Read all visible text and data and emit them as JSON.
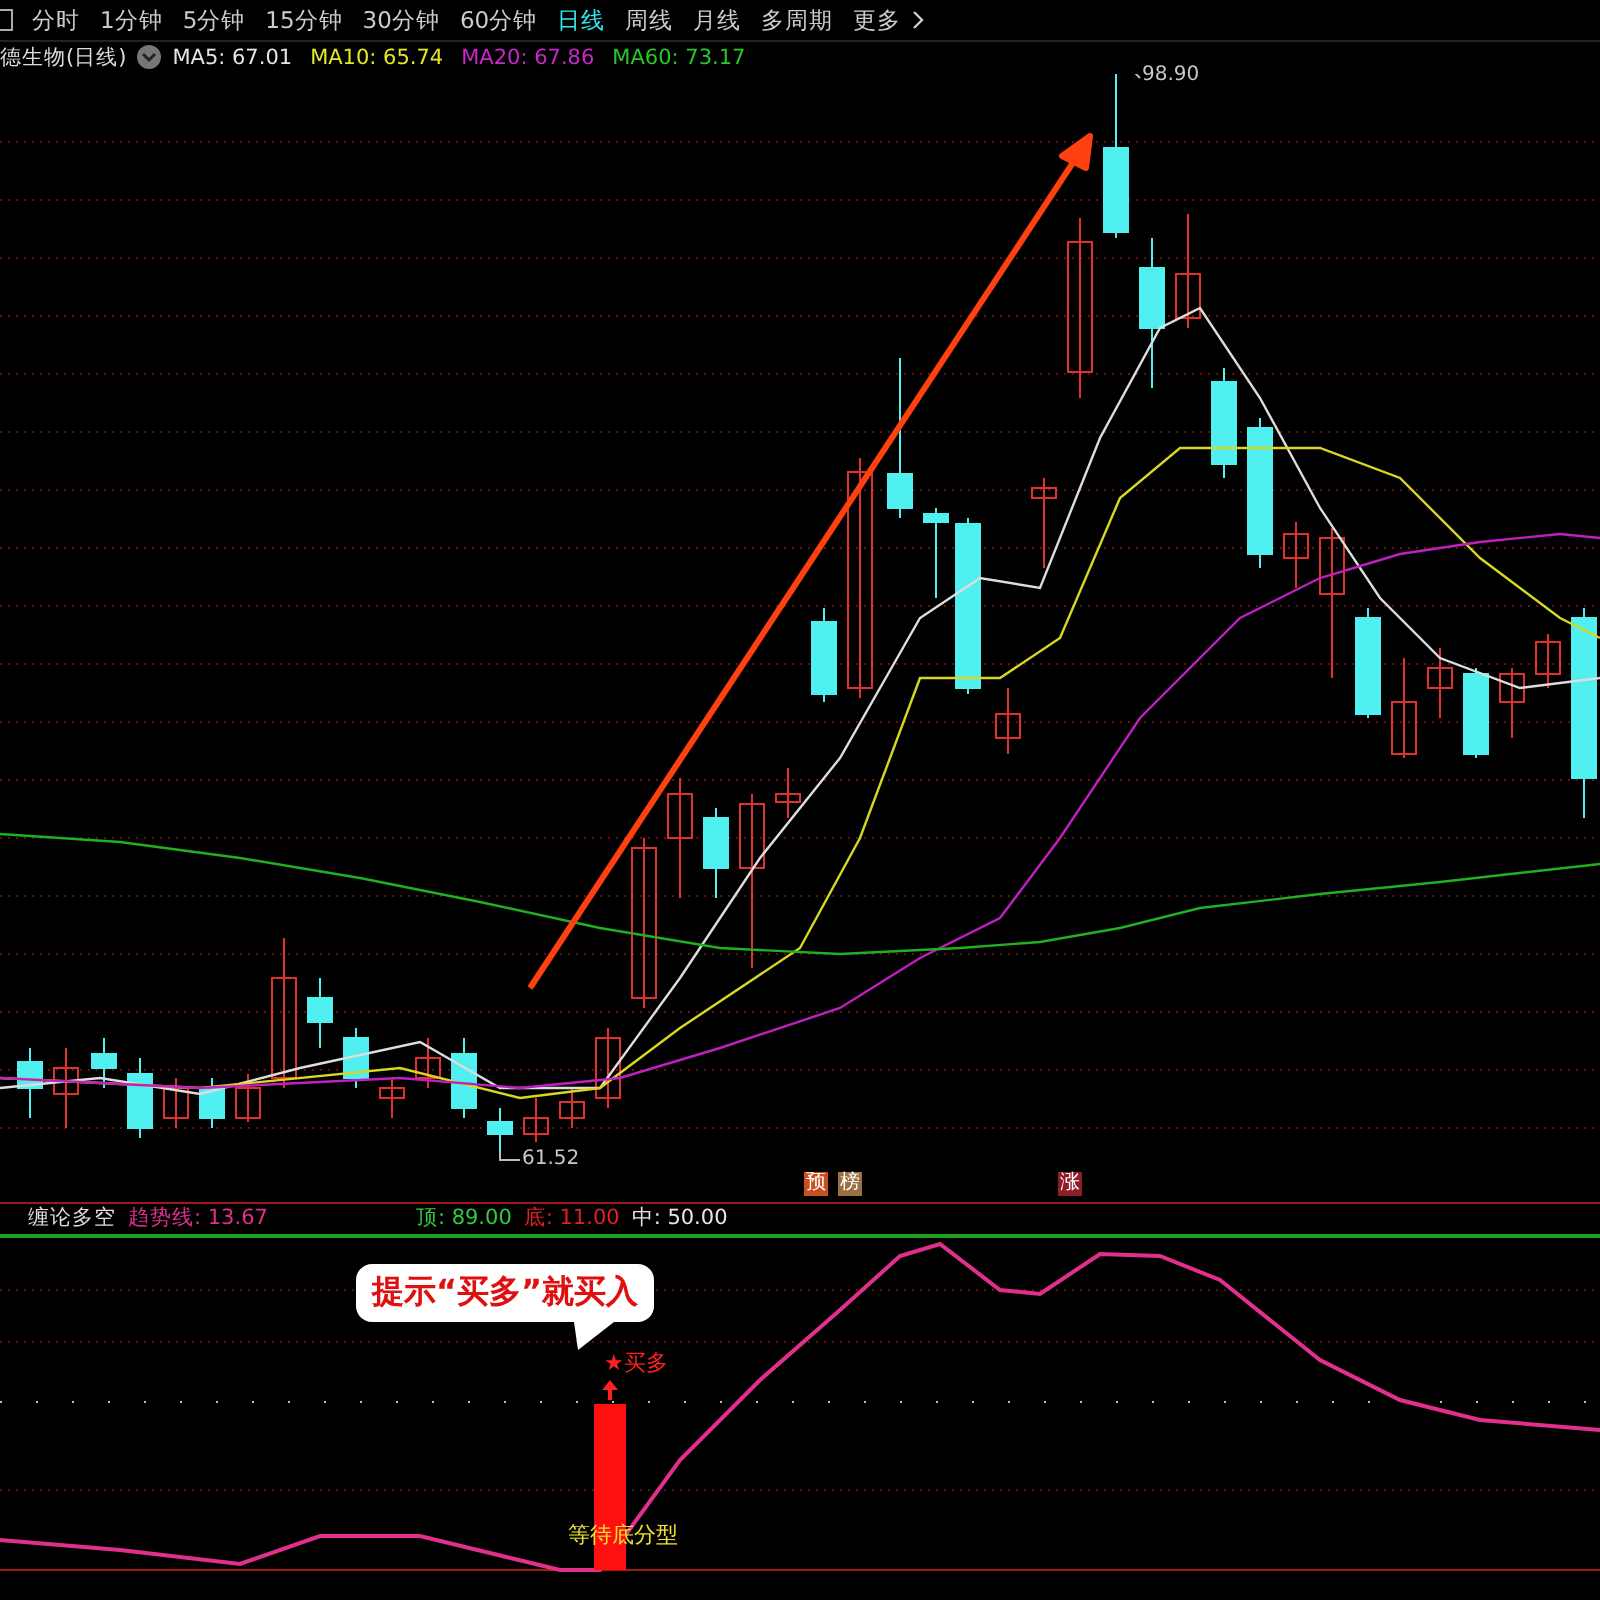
{
  "toolbar": {
    "tabs": [
      {
        "label": "分时",
        "selected": false
      },
      {
        "label": "1分钟",
        "selected": false
      },
      {
        "label": "5分钟",
        "selected": false
      },
      {
        "label": "15分钟",
        "selected": false
      },
      {
        "label": "30分钟",
        "selected": false
      },
      {
        "label": "60分钟",
        "selected": false
      },
      {
        "label": "日线",
        "selected": true
      },
      {
        "label": "周线",
        "selected": false
      },
      {
        "label": "月线",
        "selected": false
      },
      {
        "label": "多周期",
        "selected": false
      },
      {
        "label": "更多",
        "selected": false
      }
    ]
  },
  "info": {
    "name": "德生物(日线)",
    "ma": [
      {
        "label": "MA5: 67.01",
        "color": "#e6e6e6"
      },
      {
        "label": "MA10: 65.74",
        "color": "#e6e628"
      },
      {
        "label": "MA20: 67.86",
        "color": "#c828c8"
      },
      {
        "label": "MA60: 73.17",
        "color": "#28c828"
      }
    ]
  },
  "price_labels": {
    "high": "98.90",
    "low": "61.52"
  },
  "signals": [
    {
      "label": "预",
      "color": "#c8501e"
    },
    {
      "label": "榜",
      "color": "#9a7040"
    },
    {
      "label": "涨",
      "color": "#8c1e28"
    }
  ],
  "indicator": {
    "name": "缠论多空",
    "values": [
      {
        "text": "趋势线: 13.67",
        "kind": "trend"
      },
      {
        "text": "顶: 89.00",
        "kind": "top"
      },
      {
        "text": "底: 11.00",
        "kind": "bottom"
      },
      {
        "text": "中: 50.00",
        "kind": "middle"
      }
    ]
  },
  "callout": "提示“买多”就买入",
  "buy_signal": "★买多",
  "wait_label": "等待底分型"
}
